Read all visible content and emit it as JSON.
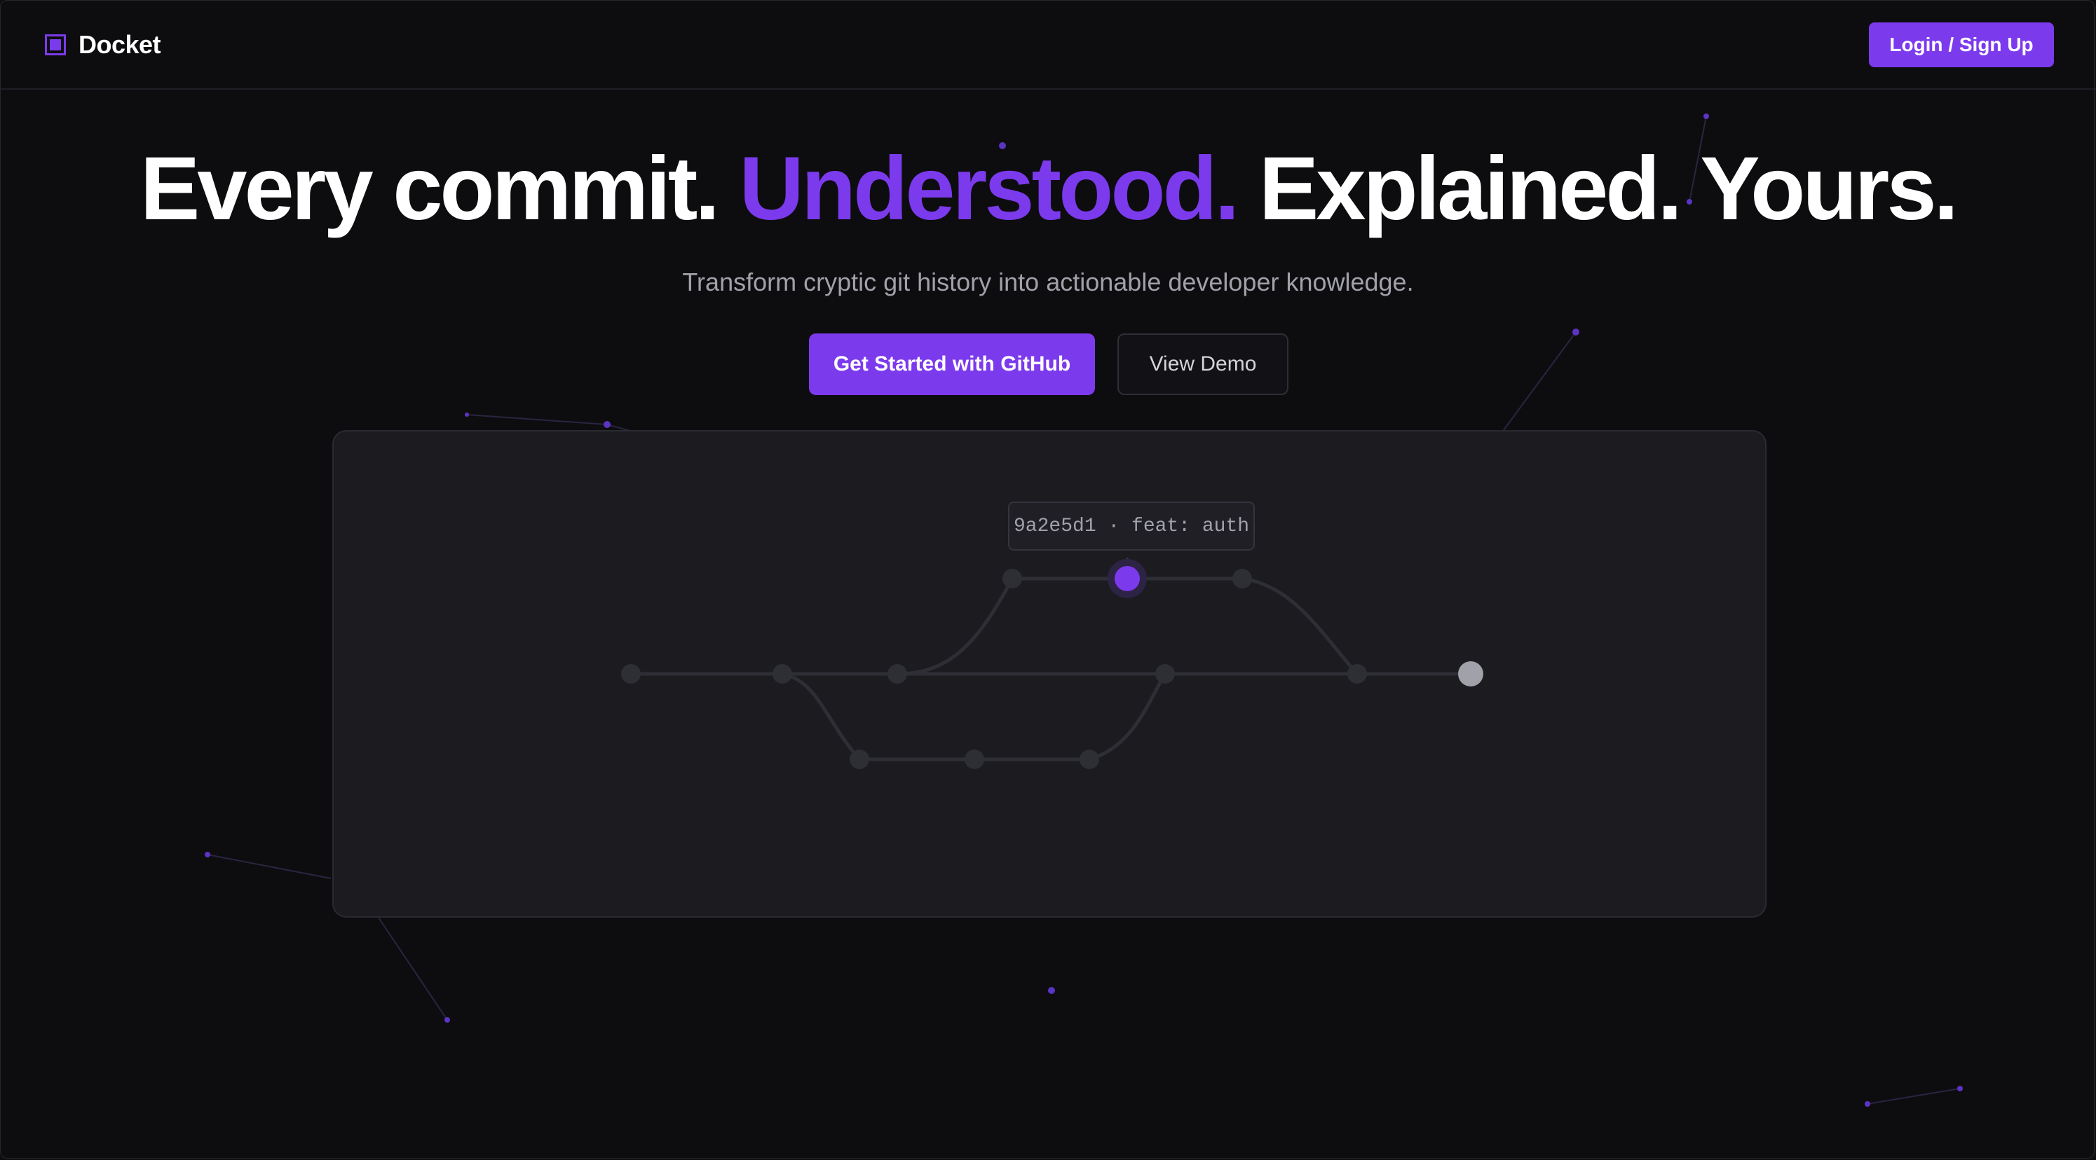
{
  "nav": {
    "brand": "Docket",
    "login_label": "Login / Sign Up"
  },
  "hero": {
    "headline_part1": "Every commit.",
    "headline_accent": "Understood.",
    "headline_part2": "Explained. Yours.",
    "subtitle": "Transform cryptic git history into actionable developer knowledge.",
    "cta_primary": "Get Started with GitHub",
    "cta_secondary": "View Demo"
  },
  "graph": {
    "tooltip": "9a2e5d1 · feat: auth"
  },
  "colors": {
    "accent": "#7c3aed",
    "background": "#0d0d10",
    "panel": "#1b1b20",
    "node": "#2e2e35",
    "head_node": "#a1a1aa"
  },
  "icons": {
    "brand": "square-logo-icon"
  }
}
